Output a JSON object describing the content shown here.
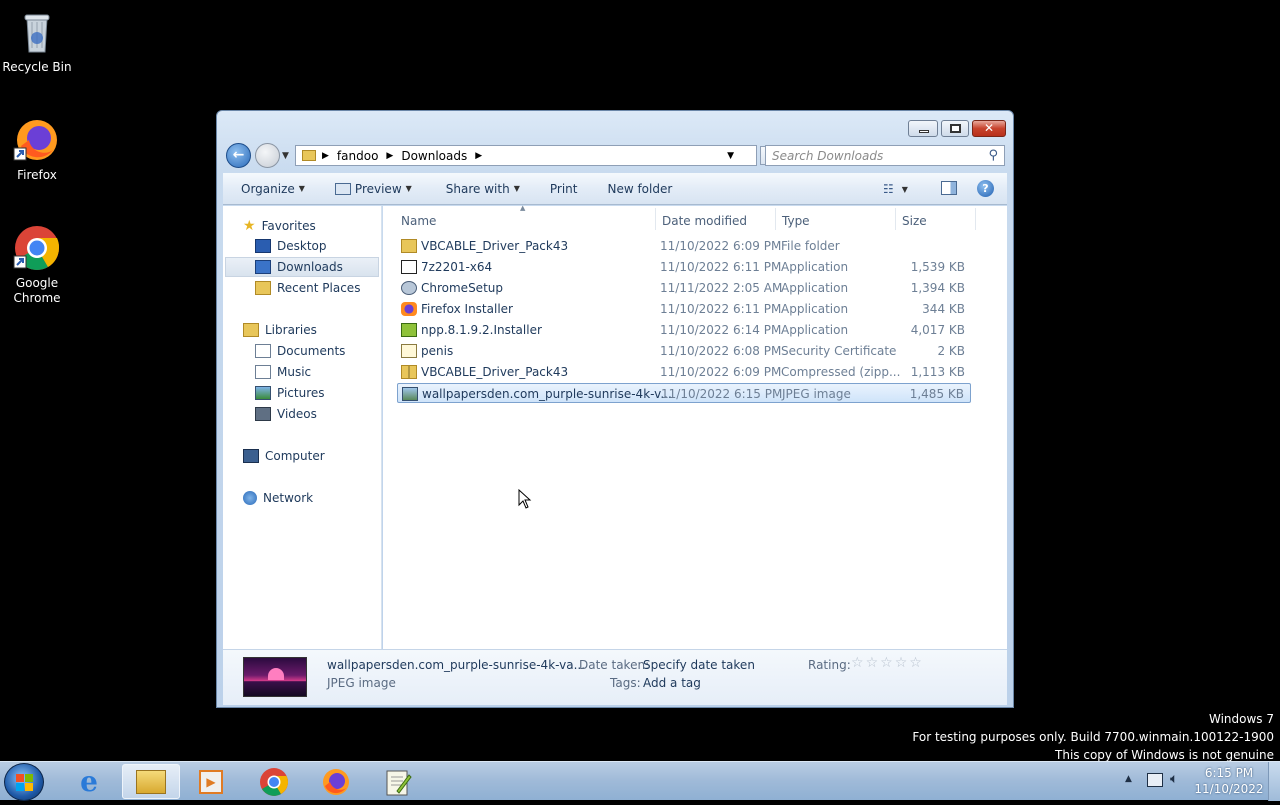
{
  "desktop": {
    "icons": [
      {
        "label": "Recycle Bin"
      },
      {
        "label": "Firefox"
      },
      {
        "label": "Google Chrome"
      }
    ]
  },
  "window": {
    "breadcrumb": [
      "fandoo",
      "Downloads"
    ],
    "search_placeholder": "Search Downloads",
    "toolbar": {
      "organize": "Organize",
      "preview": "Preview",
      "share_with": "Share with",
      "print": "Print",
      "new_folder": "New folder"
    },
    "nav": {
      "favorites": "Favorites",
      "desktop": "Desktop",
      "downloads": "Downloads",
      "recent_places": "Recent Places",
      "libraries": "Libraries",
      "documents": "Documents",
      "music": "Music",
      "pictures": "Pictures",
      "videos": "Videos",
      "computer": "Computer",
      "network": "Network"
    },
    "columns": {
      "name": "Name",
      "date_modified": "Date modified",
      "type": "Type",
      "size": "Size"
    },
    "files": [
      {
        "name": "VBCABLE_Driver_Pack43",
        "date": "11/10/2022 6:09 PM",
        "type": "File folder",
        "size": "",
        "icon": "folder-icon"
      },
      {
        "name": "7z2201-x64",
        "date": "11/10/2022 6:11 PM",
        "type": "Application",
        "size": "1,539 KB",
        "icon": "7zip-icon"
      },
      {
        "name": "ChromeSetup",
        "date": "11/11/2022 2:05 AM",
        "type": "Application",
        "size": "1,394 KB",
        "icon": "setup-icon"
      },
      {
        "name": "Firefox Installer",
        "date": "11/10/2022 6:11 PM",
        "type": "Application",
        "size": "344 KB",
        "icon": "firefox-icon"
      },
      {
        "name": "npp.8.1.9.2.Installer",
        "date": "11/10/2022 6:14 PM",
        "type": "Application",
        "size": "4,017 KB",
        "icon": "installer-icon"
      },
      {
        "name": "penis",
        "date": "11/10/2022 6:08 PM",
        "type": "Security Certificate",
        "size": "2 KB",
        "icon": "certificate-icon"
      },
      {
        "name": "VBCABLE_Driver_Pack43",
        "date": "11/10/2022 6:09 PM",
        "type": "Compressed (zipp...",
        "size": "1,113 KB",
        "icon": "zip-folder-icon"
      },
      {
        "name": "wallpapersden.com_purple-sunrise-4k-v...",
        "date": "11/10/2022 6:15 PM",
        "type": "JPEG image",
        "size": "1,485 KB",
        "icon": "image-icon"
      }
    ],
    "details": {
      "filename": "wallpapersden.com_purple-sunrise-4k-va...",
      "filetype": "JPEG image",
      "date_taken_label": "Date taken:",
      "date_taken_value": "Specify date taken",
      "tags_label": "Tags:",
      "tags_value": "Add a tag",
      "rating_label": "Rating:",
      "rating_stars": 0
    }
  },
  "watermark": {
    "line1": "Windows 7",
    "line2": "For testing purposes only. Build 7700.winmain.100122-1900",
    "line3": "This copy of Windows is not genuine"
  },
  "taskbar": {
    "time": "6:15 PM",
    "date": "11/10/2022"
  }
}
